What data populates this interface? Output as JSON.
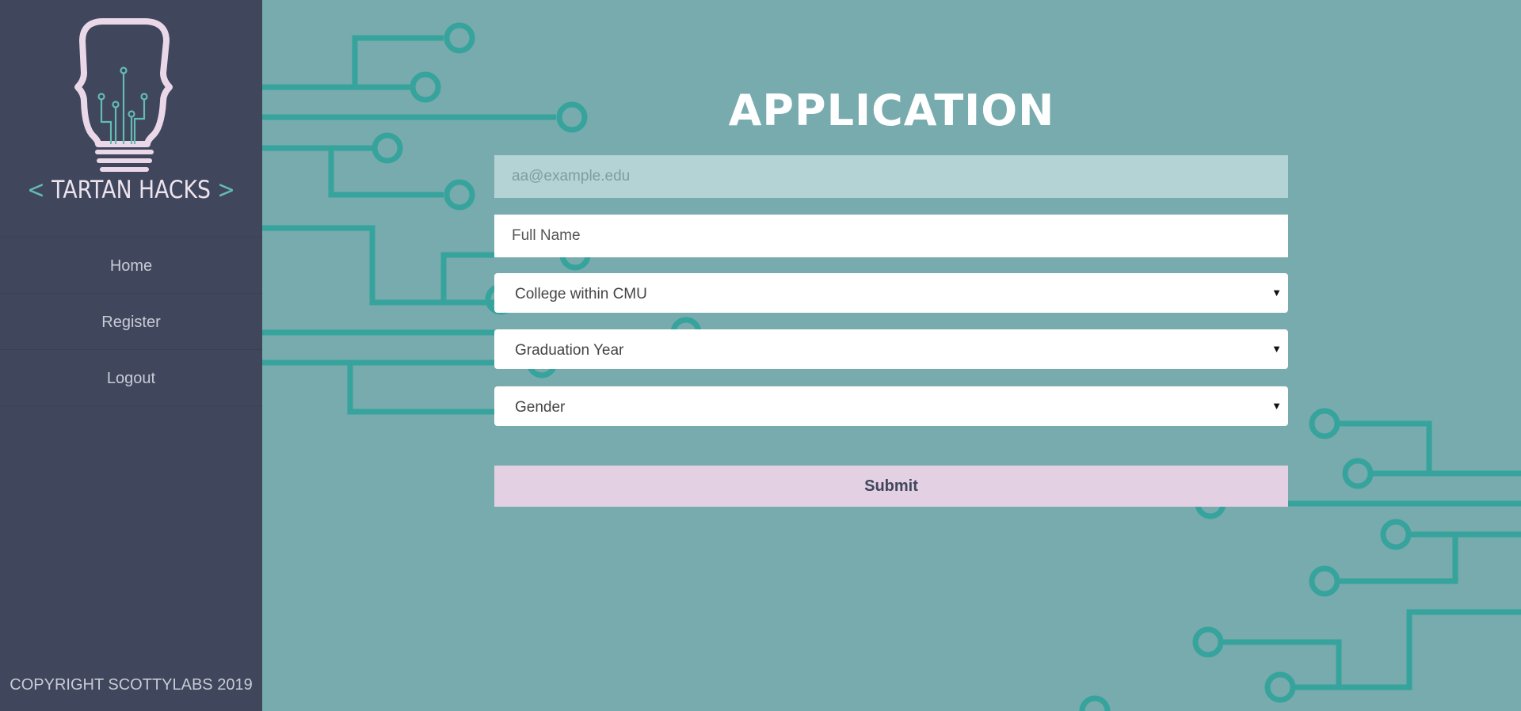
{
  "brand": {
    "name": "TARTAN HACKS",
    "open_bracket": "<",
    "close_bracket": ">"
  },
  "sidebar": {
    "items": [
      {
        "label": "Home"
      },
      {
        "label": "Register"
      },
      {
        "label": "Logout"
      }
    ],
    "copyright": "COPYRIGHT SCOTTYLABS 2019"
  },
  "main": {
    "title": "APPLICATION",
    "email": {
      "placeholder": "aa@example.edu"
    },
    "full_name": {
      "placeholder": "Full Name"
    },
    "college": {
      "value": "College within CMU"
    },
    "grad_year": {
      "value": "Graduation Year"
    },
    "gender": {
      "value": "Gender"
    },
    "submit_label": "Submit"
  },
  "colors": {
    "sidebar_bg": "#40465c",
    "main_bg": "#77abad",
    "circuit": "#36a39c",
    "submit_bg": "#e3d0e3",
    "logo_pink": "#ead8e9",
    "logo_teal": "#64bbb4"
  },
  "icons": [
    "lightbulb-logo-icon",
    "circuit-background",
    "chevron-down-icon"
  ]
}
